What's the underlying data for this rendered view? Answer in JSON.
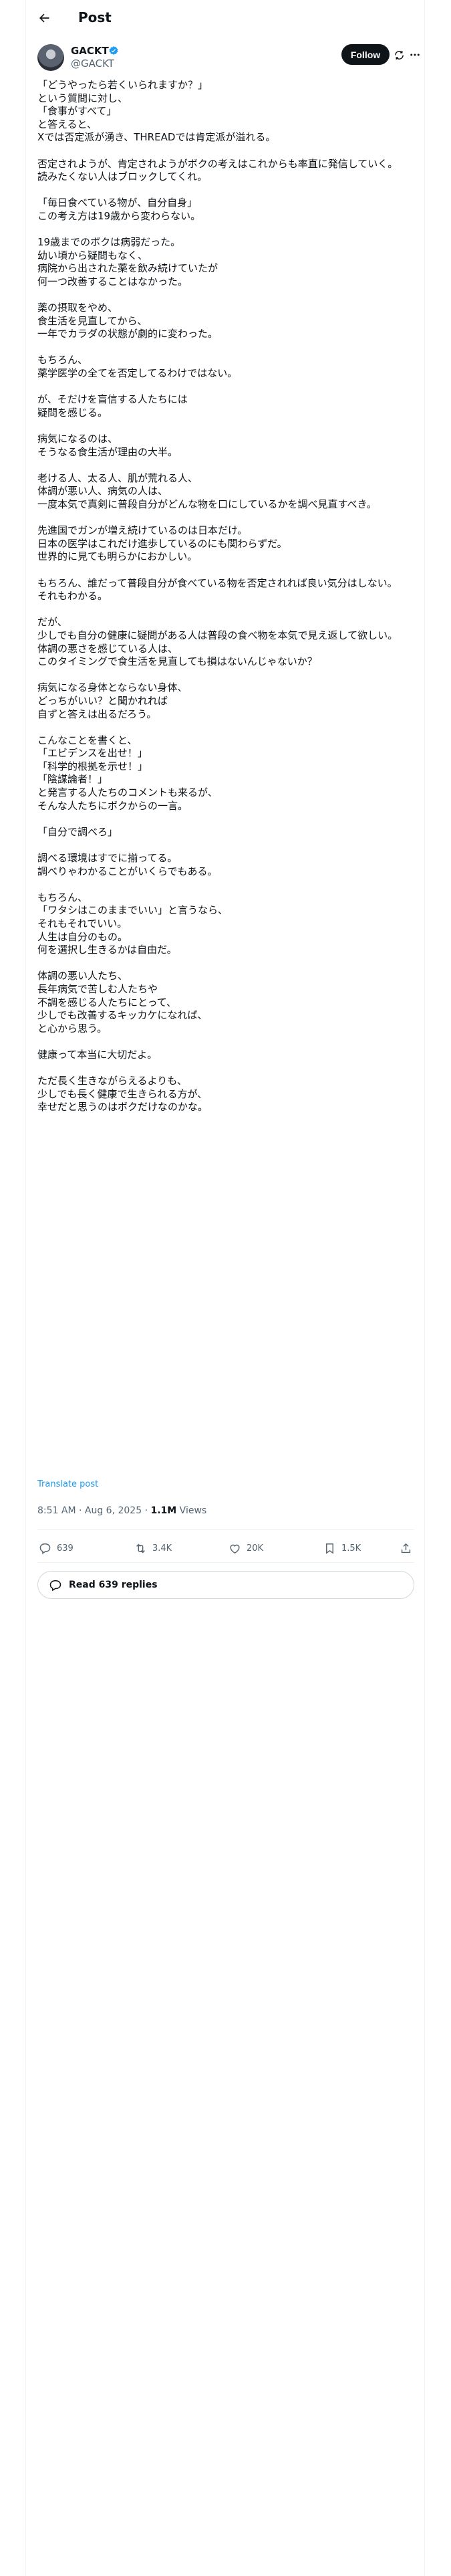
{
  "header": {
    "title": "Post"
  },
  "author": {
    "name": "GACKT",
    "handle": "@GACKT"
  },
  "buttons": {
    "follow": "Follow"
  },
  "post": {
    "lines": [
      "「どうやったら若くいられますか？」",
      "という質問に対し、",
      "「食事がすべて」",
      "と答えると、",
      "Xでは否定派が湧き、THREADでは肯定派が溢れる。",
      "",
      "否定されようが、肯定されようがボクの考えはこれからも率直に発信していく。",
      "読みたくない人はブロックしてくれ。",
      "",
      "「毎日食べている物が、自分自身」",
      "この考え方は19歳から変わらない。",
      "",
      "19歳までのボクは病弱だった。",
      "幼い頃から疑問もなく、",
      "病院から出された薬を飲み続けていたが",
      "何一つ改善することはなかった。",
      "",
      "薬の摂取をやめ、",
      "食生活を見直してから、",
      "一年でカラダの状態が劇的に変わった。",
      "",
      "もちろん、",
      "薬学医学の全てを否定してるわけではない。",
      "",
      "が、そだけを盲信する人たちには",
      "疑問を感じる。",
      "",
      "病気になるのは、",
      "そうなる食生活が理由の大半。",
      "",
      "老ける人、太る人、肌が荒れる人、",
      "体調が悪い人、病気の人は、",
      "一度本気で真剣に普段自分がどんな物を口にしているかを調べ見直すべき。",
      "",
      "先進国でガンが増え続けているのは日本だけ。",
      "日本の医学はこれだけ進歩しているのにも関わらずだ。",
      "世界的に見ても明らかにおかしい。",
      "",
      "もちろん、誰だって普段自分が食べている物を否定されれば良い気分はしない。",
      "それもわかる。",
      "",
      "だが、",
      "少しでも自分の健康に疑問がある人は普段の食べ物を本気で見え返して欲しい。",
      "体調の悪さを感じている人は、",
      "このタイミングで食生活を見直しても損はないんじゃないか？",
      "",
      "病気になる身体とならない身体、",
      "どっちがいい？と聞かれれば",
      "自ずと答えは出るだろう。",
      "",
      "こんなことを書くと、",
      "「エビデンスを出せ！」",
      "「科学的根拠を示せ！」",
      "「陰謀論者！」",
      "と発言する人たちのコメントも来るが、",
      "そんな人たちにボクからの一言。",
      "",
      "「自分で調べろ」",
      "",
      "調べる環境はすでに揃ってる。",
      "調べりゃわかることがいくらでもある。",
      "",
      "もちろん、",
      "「ワタシはこのままでいい」と言うなら、",
      "それもそれでいい。",
      "人生は自分のもの。",
      "何を選択し生きるかは自由だ。",
      "",
      "体調の悪い人たち、",
      "長年病気で苦しむ人たちや",
      "不調を感じる人たちにとって、",
      "少しでも改善するキッカケになれば、",
      "と心から思う。",
      "",
      "健康って本当に大切だよ。",
      "",
      "ただ長く生きながらえるよりも、",
      "少しでも長く健康で生きられる方が、",
      "幸せだと思うのはボクだけなのかな。"
    ],
    "translate": "Translate post",
    "time": "8:51 AM · Aug 6, 2025 · ",
    "views_count": "1.1M",
    "views_label": " Views"
  },
  "actions": {
    "replies": "639",
    "reposts": "3.4K",
    "likes": "20K",
    "bookmarks": "1.5K"
  },
  "read_replies": "Read 639 replies",
  "icons": {
    "back": "arrow-left-icon",
    "verified": "verified-badge-icon",
    "grok": "grok-icon",
    "more": "more-dots-icon",
    "reply": "reply-icon",
    "repost": "repost-icon",
    "like": "heart-icon",
    "bookmark": "bookmark-icon",
    "share": "share-icon",
    "chat": "chat-bubble-icon"
  },
  "colors": {
    "accent": "#1d9bf0",
    "text": "#0f1419",
    "muted": "#536471",
    "border": "#eff3f4"
  }
}
